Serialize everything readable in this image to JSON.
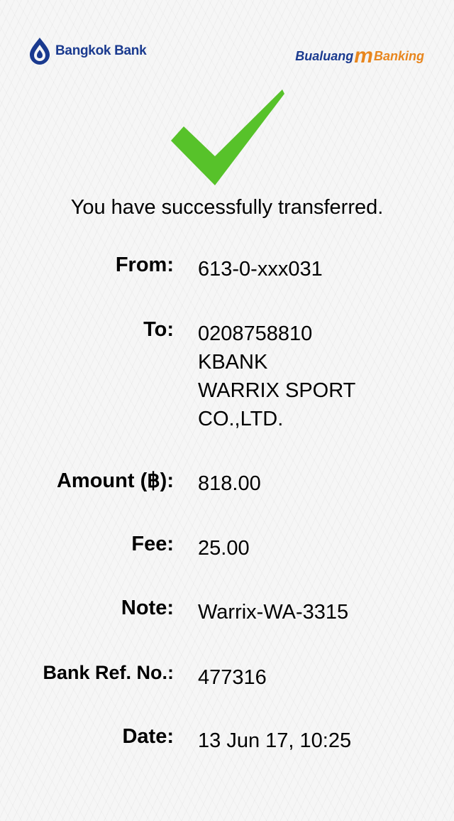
{
  "header": {
    "left_logo_text": "Bangkok Bank",
    "right_logo_part1": "Bualuang",
    "right_logo_m": "m",
    "right_logo_part2": "Banking",
    "colors": {
      "brand_blue": "#1a3a8f",
      "brand_orange": "#e8861e",
      "success_green": "#57c22a"
    }
  },
  "status": {
    "icon": "checkmark-icon",
    "message": "You have successfully transferred."
  },
  "details": {
    "from_label": "From:",
    "from_value": "613-0-xxx031",
    "to_label": "To:",
    "to_lines": [
      "0208758810",
      "KBANK",
      "WARRIX SPORT",
      "CO.,LTD."
    ],
    "amount_label": "Amount (฿):",
    "amount_value": "818.00",
    "fee_label": "Fee:",
    "fee_value": "25.00",
    "note_label": "Note:",
    "note_value": "Warrix-WA-3315",
    "ref_label": "Bank Ref. No.:",
    "ref_value": "477316",
    "date_label": "Date:",
    "date_value": "13 Jun 17, 10:25"
  }
}
